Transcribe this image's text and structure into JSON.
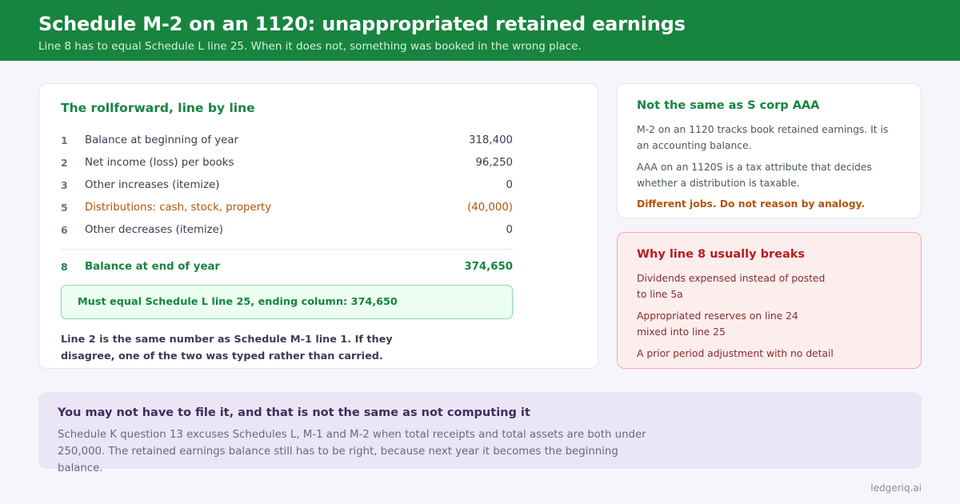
{
  "header": {
    "title": "Schedule M-2 on an 1120: unappropriated retained earnings",
    "subtitle": "Line 8 has to equal Schedule L line 25. When it does not, something was booked in the wrong place."
  },
  "rollforward": {
    "title": "The rollforward, line by line",
    "rows": [
      {
        "num": "1",
        "label": "Balance at beginning of year",
        "value": "318,400"
      },
      {
        "num": "2",
        "label": "Net income (loss) per books",
        "value": "96,250"
      },
      {
        "num": "3",
        "label": "Other increases (itemize)",
        "value": "0"
      },
      {
        "num": "5",
        "label": "Distributions: cash, stock, property",
        "value": "(40,000)"
      },
      {
        "num": "6",
        "label": "Other decreases (itemize)",
        "value": "0"
      }
    ],
    "total": {
      "num": "8",
      "label": "Balance at end of year",
      "value": "374,650"
    },
    "must_equal": "Must equal Schedule L line 25, ending column: 374,650",
    "note": "Line 2 is the same number as Schedule M-1 line 1. If they disagree, one of the two was typed rather than carried."
  },
  "aaa_card": {
    "title": "Not the same as S corp AAA",
    "p1": "M-2 on an 1120 tracks book retained earnings. It is an accounting balance.",
    "p2": "AAA on an 1120S is a tax attribute that decides whether a distribution is taxable.",
    "warning": "Different jobs. Do not reason by analogy."
  },
  "why_card": {
    "title": "Why line 8 usually breaks",
    "items": [
      "Dividends expensed instead of posted to line 5a",
      "Appropriated reserves on line 24 mixed into line 25",
      "A prior period adjustment with no detail"
    ]
  },
  "bottom": {
    "title": "You may not have to file it, and that is not the same as not computing it",
    "text": "Schedule K question 13 excuses Schedules L, M-1 and M-2 when total receipts and total assets are both under 250,000. The retained earnings balance still has to be right, because next year it becomes the beginning balance."
  },
  "brand": "ledgeriq.ai",
  "colors": {
    "header_green": "#17843f",
    "accent_orange": "#b45309",
    "alert_red": "#b91c1c",
    "bottom_purple": "#ebe6f5"
  }
}
